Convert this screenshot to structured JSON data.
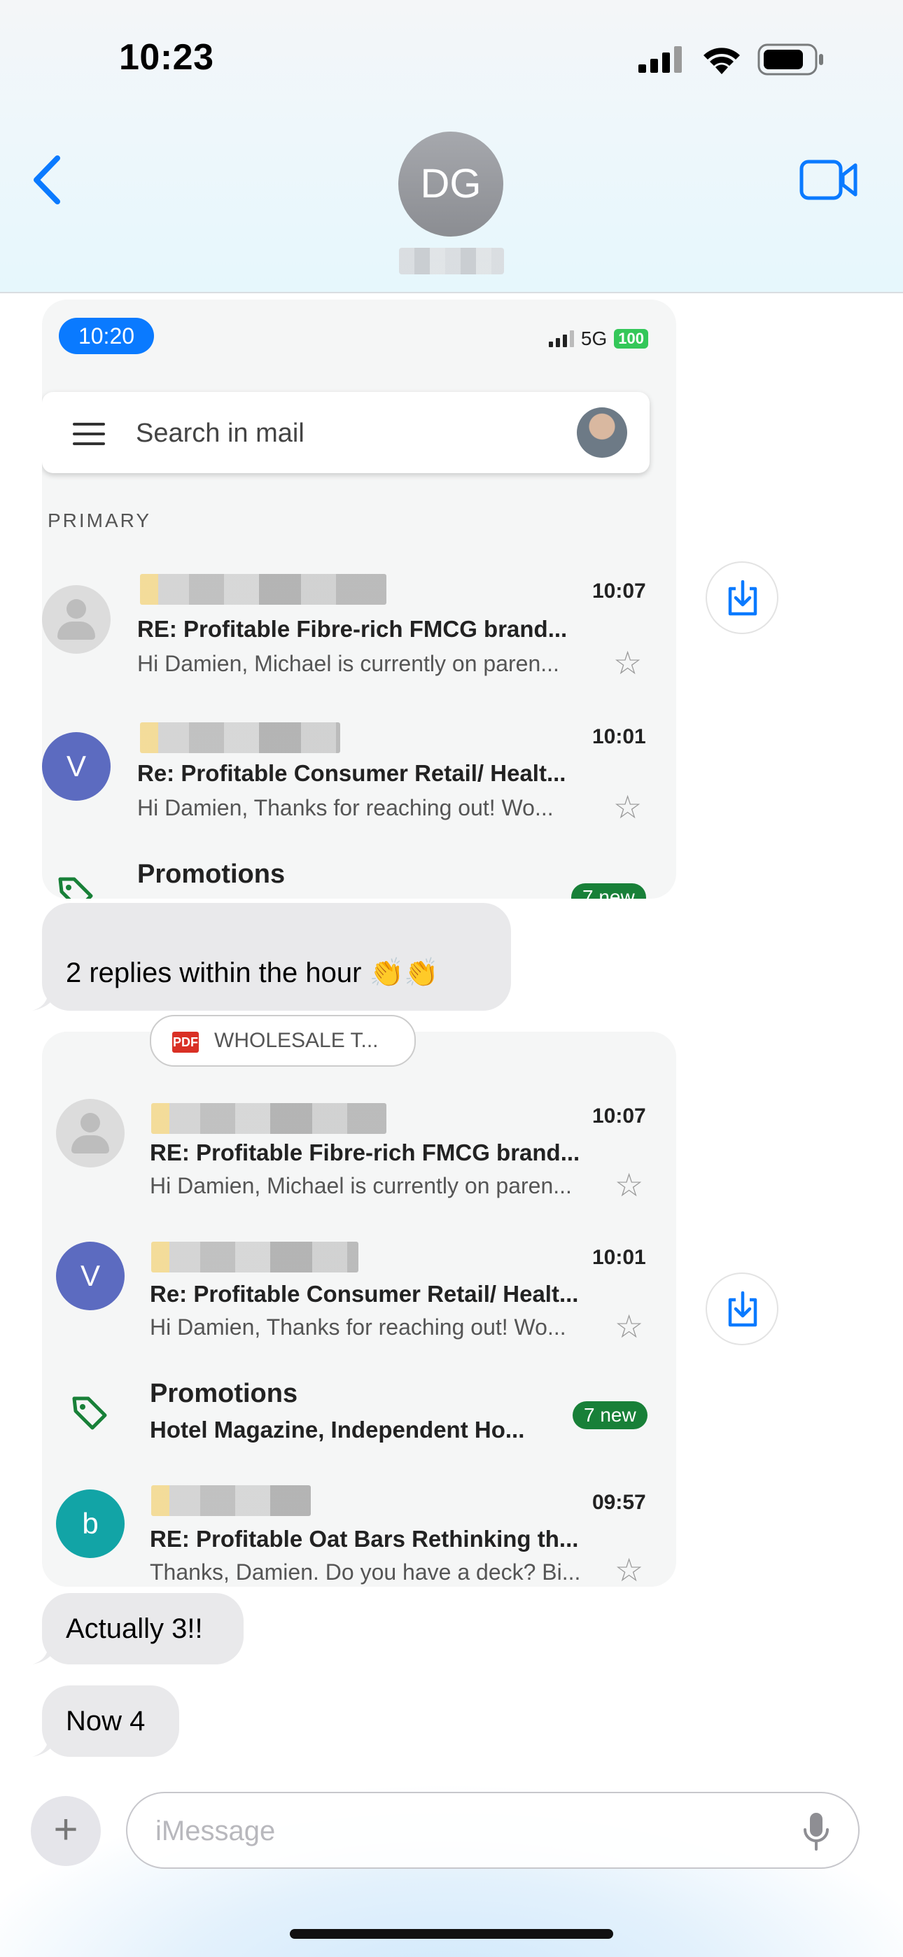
{
  "status_bar": {
    "time": "10:23"
  },
  "header": {
    "contact_initials": "DG"
  },
  "screenshot1": {
    "status_time": "10:20",
    "network": "5G",
    "battery": "100",
    "search_placeholder": "Search in mail",
    "section_label": "PRIMARY",
    "emails": [
      {
        "avatar": "",
        "time": "10:07",
        "subject": "RE: Profitable Fibre-rich FMCG brand...",
        "preview": "Hi Damien, Michael is currently on paren..."
      },
      {
        "avatar": "V",
        "time": "10:01",
        "subject": "Re: Profitable Consumer Retail/ Healt...",
        "preview": "Hi Damien, Thanks for reaching out! Wo..."
      }
    ],
    "promotions": {
      "title": "Promotions",
      "badge": "7 new"
    }
  },
  "bubble1": {
    "text": "2 replies within the hour 👏👏"
  },
  "screenshot2": {
    "attachment": {
      "type": "PDF",
      "name": "WHOLESALE T..."
    },
    "emails": [
      {
        "avatar": "",
        "time": "10:07",
        "subject": "RE: Profitable Fibre-rich FMCG brand...",
        "preview": "Hi Damien, Michael is currently on paren..."
      },
      {
        "avatar": "V",
        "time": "10:01",
        "subject": "Re: Profitable Consumer Retail/ Healt...",
        "preview": "Hi Damien, Thanks for reaching out! Wo..."
      },
      {
        "avatar": "b",
        "time": "09:57",
        "subject": "RE: Profitable Oat Bars Rethinking th...",
        "preview": "Thanks, Damien. Do you have a deck? Bi..."
      }
    ],
    "promotions": {
      "title": "Promotions",
      "subtitle": "Hotel Magazine, Independent Ho...",
      "badge": "7 new"
    }
  },
  "bubble2": {
    "text": "Actually 3!!"
  },
  "bubble3": {
    "text": "Now 4"
  },
  "composer": {
    "placeholder": "iMessage"
  },
  "colors": {
    "ios_blue": "#0a7aff",
    "avatar_v": "#5c6bc0",
    "avatar_b": "#12a4a6",
    "badge_green": "#188038"
  }
}
